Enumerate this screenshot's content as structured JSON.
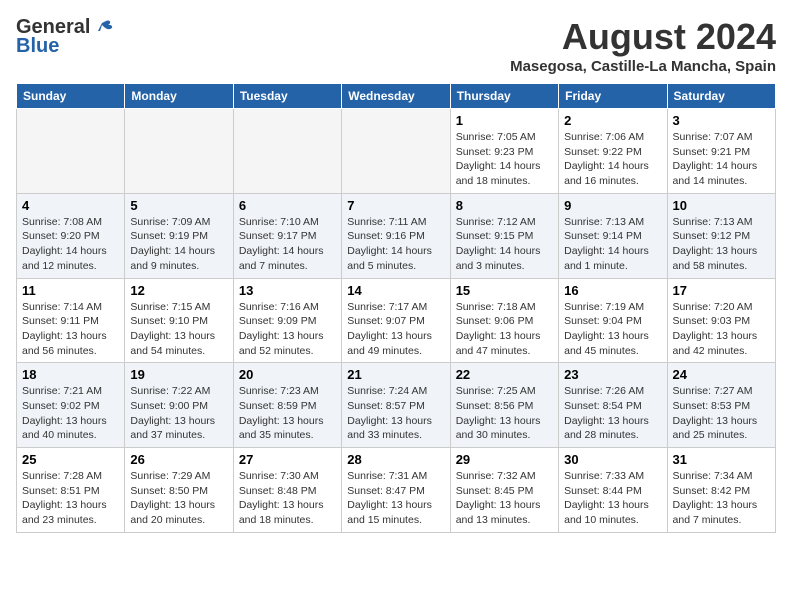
{
  "header": {
    "logo_general": "General",
    "logo_blue": "Blue",
    "month_year": "August 2024",
    "location": "Masegosa, Castille-La Mancha, Spain"
  },
  "weekdays": [
    "Sunday",
    "Monday",
    "Tuesday",
    "Wednesday",
    "Thursday",
    "Friday",
    "Saturday"
  ],
  "weeks": [
    [
      {
        "day": "",
        "info": ""
      },
      {
        "day": "",
        "info": ""
      },
      {
        "day": "",
        "info": ""
      },
      {
        "day": "",
        "info": ""
      },
      {
        "day": "1",
        "info": "Sunrise: 7:05 AM\nSunset: 9:23 PM\nDaylight: 14 hours\nand 18 minutes."
      },
      {
        "day": "2",
        "info": "Sunrise: 7:06 AM\nSunset: 9:22 PM\nDaylight: 14 hours\nand 16 minutes."
      },
      {
        "day": "3",
        "info": "Sunrise: 7:07 AM\nSunset: 9:21 PM\nDaylight: 14 hours\nand 14 minutes."
      }
    ],
    [
      {
        "day": "4",
        "info": "Sunrise: 7:08 AM\nSunset: 9:20 PM\nDaylight: 14 hours\nand 12 minutes."
      },
      {
        "day": "5",
        "info": "Sunrise: 7:09 AM\nSunset: 9:19 PM\nDaylight: 14 hours\nand 9 minutes."
      },
      {
        "day": "6",
        "info": "Sunrise: 7:10 AM\nSunset: 9:17 PM\nDaylight: 14 hours\nand 7 minutes."
      },
      {
        "day": "7",
        "info": "Sunrise: 7:11 AM\nSunset: 9:16 PM\nDaylight: 14 hours\nand 5 minutes."
      },
      {
        "day": "8",
        "info": "Sunrise: 7:12 AM\nSunset: 9:15 PM\nDaylight: 14 hours\nand 3 minutes."
      },
      {
        "day": "9",
        "info": "Sunrise: 7:13 AM\nSunset: 9:14 PM\nDaylight: 14 hours\nand 1 minute."
      },
      {
        "day": "10",
        "info": "Sunrise: 7:13 AM\nSunset: 9:12 PM\nDaylight: 13 hours\nand 58 minutes."
      }
    ],
    [
      {
        "day": "11",
        "info": "Sunrise: 7:14 AM\nSunset: 9:11 PM\nDaylight: 13 hours\nand 56 minutes."
      },
      {
        "day": "12",
        "info": "Sunrise: 7:15 AM\nSunset: 9:10 PM\nDaylight: 13 hours\nand 54 minutes."
      },
      {
        "day": "13",
        "info": "Sunrise: 7:16 AM\nSunset: 9:09 PM\nDaylight: 13 hours\nand 52 minutes."
      },
      {
        "day": "14",
        "info": "Sunrise: 7:17 AM\nSunset: 9:07 PM\nDaylight: 13 hours\nand 49 minutes."
      },
      {
        "day": "15",
        "info": "Sunrise: 7:18 AM\nSunset: 9:06 PM\nDaylight: 13 hours\nand 47 minutes."
      },
      {
        "day": "16",
        "info": "Sunrise: 7:19 AM\nSunset: 9:04 PM\nDaylight: 13 hours\nand 45 minutes."
      },
      {
        "day": "17",
        "info": "Sunrise: 7:20 AM\nSunset: 9:03 PM\nDaylight: 13 hours\nand 42 minutes."
      }
    ],
    [
      {
        "day": "18",
        "info": "Sunrise: 7:21 AM\nSunset: 9:02 PM\nDaylight: 13 hours\nand 40 minutes."
      },
      {
        "day": "19",
        "info": "Sunrise: 7:22 AM\nSunset: 9:00 PM\nDaylight: 13 hours\nand 37 minutes."
      },
      {
        "day": "20",
        "info": "Sunrise: 7:23 AM\nSunset: 8:59 PM\nDaylight: 13 hours\nand 35 minutes."
      },
      {
        "day": "21",
        "info": "Sunrise: 7:24 AM\nSunset: 8:57 PM\nDaylight: 13 hours\nand 33 minutes."
      },
      {
        "day": "22",
        "info": "Sunrise: 7:25 AM\nSunset: 8:56 PM\nDaylight: 13 hours\nand 30 minutes."
      },
      {
        "day": "23",
        "info": "Sunrise: 7:26 AM\nSunset: 8:54 PM\nDaylight: 13 hours\nand 28 minutes."
      },
      {
        "day": "24",
        "info": "Sunrise: 7:27 AM\nSunset: 8:53 PM\nDaylight: 13 hours\nand 25 minutes."
      }
    ],
    [
      {
        "day": "25",
        "info": "Sunrise: 7:28 AM\nSunset: 8:51 PM\nDaylight: 13 hours\nand 23 minutes."
      },
      {
        "day": "26",
        "info": "Sunrise: 7:29 AM\nSunset: 8:50 PM\nDaylight: 13 hours\nand 20 minutes."
      },
      {
        "day": "27",
        "info": "Sunrise: 7:30 AM\nSunset: 8:48 PM\nDaylight: 13 hours\nand 18 minutes."
      },
      {
        "day": "28",
        "info": "Sunrise: 7:31 AM\nSunset: 8:47 PM\nDaylight: 13 hours\nand 15 minutes."
      },
      {
        "day": "29",
        "info": "Sunrise: 7:32 AM\nSunset: 8:45 PM\nDaylight: 13 hours\nand 13 minutes."
      },
      {
        "day": "30",
        "info": "Sunrise: 7:33 AM\nSunset: 8:44 PM\nDaylight: 13 hours\nand 10 minutes."
      },
      {
        "day": "31",
        "info": "Sunrise: 7:34 AM\nSunset: 8:42 PM\nDaylight: 13 hours\nand 7 minutes."
      }
    ]
  ]
}
